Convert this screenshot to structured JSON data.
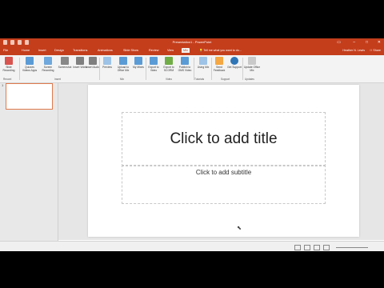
{
  "window": {
    "title": "Presentation1 - PowerPoint",
    "user": "Heather N. Lewis",
    "controls": [
      "restore-icon",
      "minimize-icon",
      "maximize-icon",
      "close-icon"
    ]
  },
  "tabs": [
    "File",
    "Home",
    "Insert",
    "Design",
    "Transitions",
    "Animations",
    "Slide Show",
    "Review",
    "View",
    "Mix"
  ],
  "active_tab": "Mix",
  "tell_me": "Tell me what you want to do...",
  "share_label": "Share",
  "ribbon": {
    "buttons": [
      {
        "label": "Slide Recording",
        "icon": "record-icon"
      },
      {
        "label": "Quizzes Videos Apps",
        "icon": "quiz-icon"
      },
      {
        "label": "Screen Recording",
        "icon": "screen-record-icon"
      },
      {
        "label": "Screenshot",
        "icon": "screenshot-icon"
      },
      {
        "label": "Insert Video",
        "icon": "video-icon"
      },
      {
        "label": "Insert Audio",
        "icon": "audio-icon"
      },
      {
        "label": "Preview",
        "icon": "preview-icon"
      },
      {
        "label": "Upload to Office Mix",
        "icon": "upload-icon"
      },
      {
        "label": "My Mixes",
        "icon": "mixes-icon"
      },
      {
        "label": "Export to Video",
        "icon": "export-video-icon"
      },
      {
        "label": "Export to SCORM",
        "icon": "scorm-icon"
      },
      {
        "label": "Publish to OMS Video",
        "icon": "publish-icon"
      },
      {
        "label": "Using Mix",
        "icon": "help-mix-icon"
      },
      {
        "label": "Send Feedback",
        "icon": "feedback-icon"
      },
      {
        "label": "Get Support",
        "icon": "support-icon"
      },
      {
        "label": "Update Office Mix",
        "icon": "update-icon"
      }
    ],
    "groups": [
      "Record",
      "Insert",
      "Mix",
      "Video",
      "Tutorials",
      "Support",
      "Updates"
    ]
  },
  "slides": [
    {
      "number": "1"
    }
  ],
  "slide": {
    "title_placeholder": "Click to add title",
    "subtitle_placeholder": "Click to add subtitle"
  },
  "colors": {
    "accent": "#c43e1c",
    "ribbon_bg": "#f3f3f3",
    "canvas_bg": "#e6e6e6"
  }
}
